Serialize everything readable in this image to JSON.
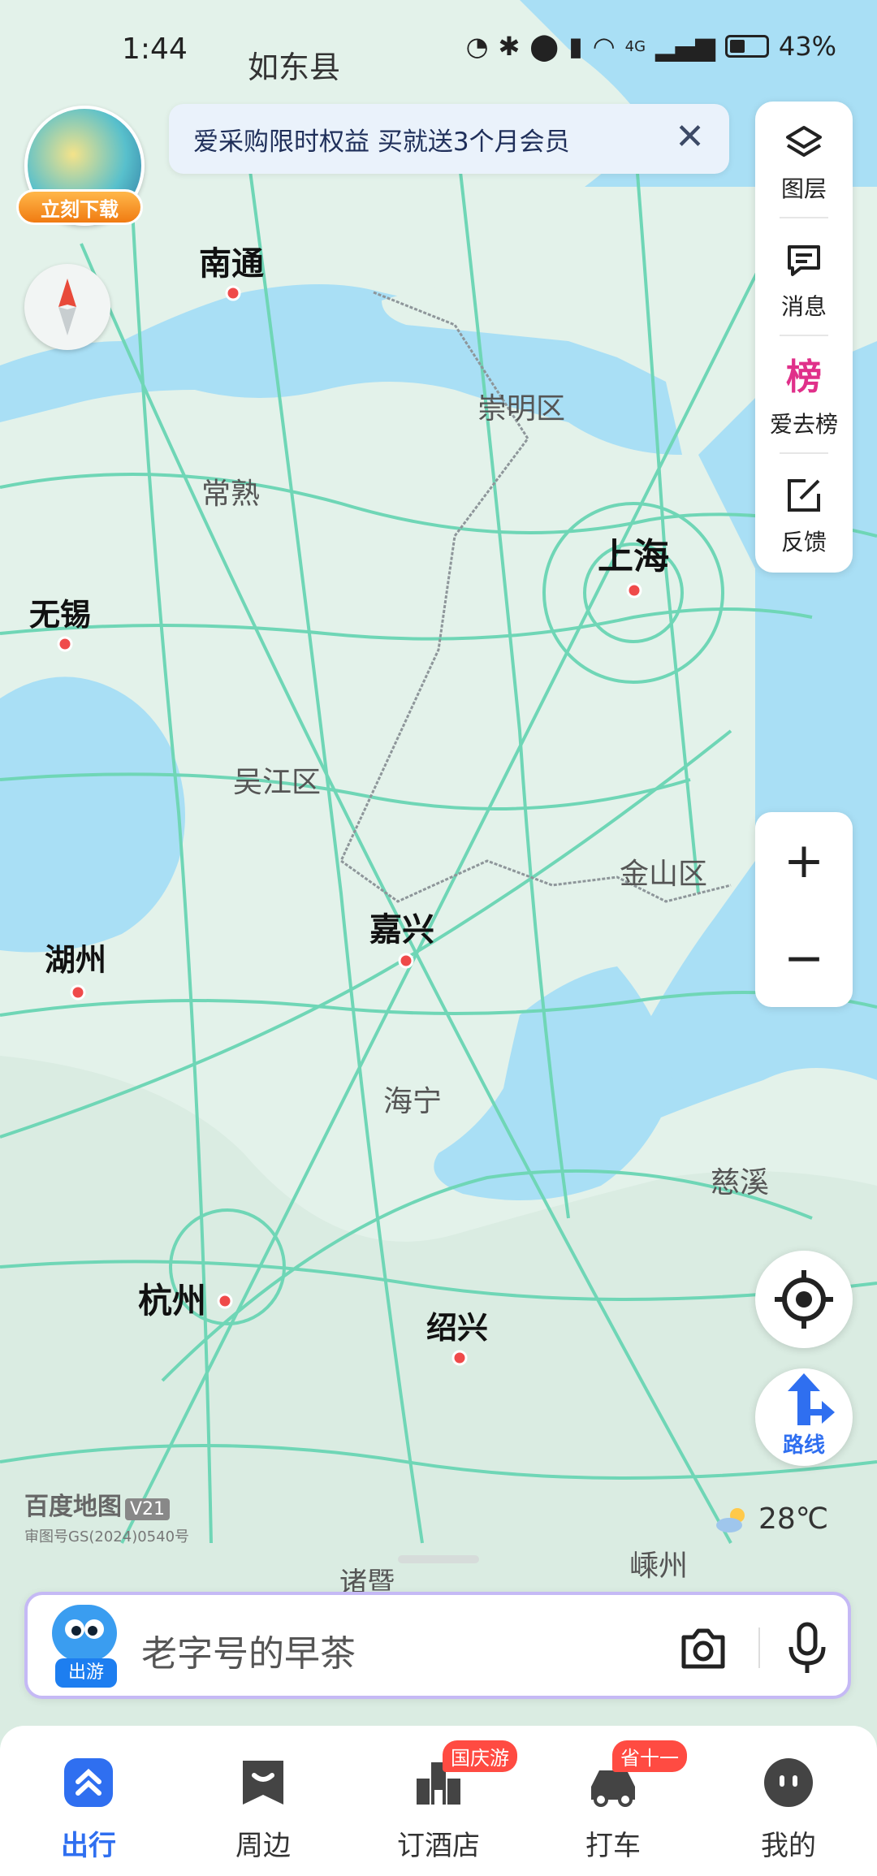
{
  "status_bar": {
    "time": "1:44",
    "network": "4G",
    "battery": "43%",
    "battery_level": 0.43
  },
  "banner": {
    "text": "爱采购限时权益 买就送3个月会员",
    "close": "✕"
  },
  "download_badge": {
    "label": "立刻下载"
  },
  "side_panel": {
    "items": [
      {
        "label": "图层",
        "icon": "layers-icon"
      },
      {
        "label": "消息",
        "icon": "message-icon"
      },
      {
        "label": "爱去榜",
        "icon": "ranking-icon",
        "icon_text": "榜"
      },
      {
        "label": "反馈",
        "icon": "feedback-icon"
      }
    ]
  },
  "zoom": {
    "in": "+",
    "out": "−"
  },
  "route_button": {
    "label": "路线"
  },
  "map": {
    "labels": {
      "rudong": "如东县",
      "nantong": "南通",
      "chongming": "崇明区",
      "changshu": "常熟",
      "shanghai": "上海",
      "wuxi": "无锡",
      "wujiang": "吴江区",
      "jinshan": "金山区",
      "jiaxing": "嘉兴",
      "huzhou": "湖州",
      "haining": "海宁",
      "cixi": "慈溪",
      "hangzhou": "杭州",
      "shaoxing": "绍兴",
      "zhuji": "诸暨",
      "shengzhou": "嵊州"
    },
    "colors": {
      "land": "#e3f2ea",
      "water": "#a9dff5",
      "road": "#6fd6b6",
      "boundary": "#8e969a"
    }
  },
  "branding": {
    "logo_text": "百度地图",
    "version": "V21",
    "approval": "审图号GS(2024)0540号"
  },
  "weather": {
    "temperature": "28℃"
  },
  "search": {
    "placeholder": "老字号的早茶",
    "mascot_tag": "出游"
  },
  "tabs": [
    {
      "label": "出行",
      "active": true
    },
    {
      "label": "周边"
    },
    {
      "label": "订酒店",
      "badge": "国庆游"
    },
    {
      "label": "打车",
      "badge": "省十一"
    },
    {
      "label": "我的"
    }
  ],
  "accent_color": "#2f6ff0"
}
